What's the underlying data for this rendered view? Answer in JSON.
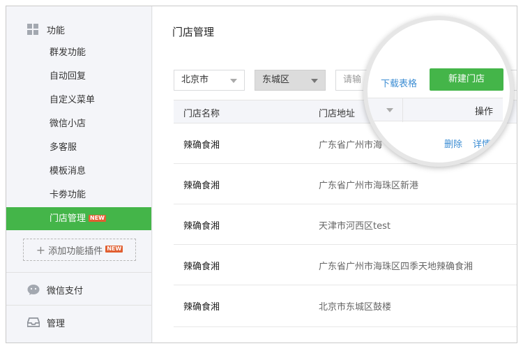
{
  "sidebar": {
    "function_group": {
      "label": "功能",
      "icon": "grid-icon"
    },
    "items": [
      {
        "label": "群发功能"
      },
      {
        "label": "自动回复"
      },
      {
        "label": "自定义菜单"
      },
      {
        "label": "微信小店"
      },
      {
        "label": "多客服"
      },
      {
        "label": "模板消息"
      },
      {
        "label": "卡劵功能"
      },
      {
        "label": "门店管理",
        "badge": "NEW",
        "active": true
      }
    ],
    "add_plugin": {
      "label": "添加功能插件",
      "badge": "NEW"
    },
    "pay_group": {
      "label": "微信支付",
      "icon": "wechat-icon"
    },
    "manage_group": {
      "label": "管理",
      "icon": "inbox-icon"
    }
  },
  "main": {
    "title": "门店管理",
    "filters": {
      "city": "北京市",
      "district": "东城区",
      "search_placeholder": "请输"
    },
    "table": {
      "headers": {
        "name": "门店名称",
        "address": "门店地址",
        "action": "操作"
      },
      "rows": [
        {
          "name": "辣确食湘",
          "address": "广东省广州市海"
        },
        {
          "name": "辣确食湘",
          "address": "广东省广州市海珠区新港"
        },
        {
          "name": "辣确食湘",
          "address": "天津市河西区test"
        },
        {
          "name": "辣确食湘",
          "address": "广东省广州市海珠区四季天地辣确食湘"
        },
        {
          "name": "辣确食湘",
          "address": "北京市东城区鼓楼"
        }
      ]
    }
  },
  "magnifier": {
    "download_label": "下载表格",
    "new_store_label": "新建门店",
    "action_header": "操作",
    "delete_label": "删除",
    "detail_label": "详情"
  },
  "colors": {
    "accent_green": "#44b549",
    "link_blue": "#3c8dd3",
    "badge_red": "#e15f31"
  }
}
